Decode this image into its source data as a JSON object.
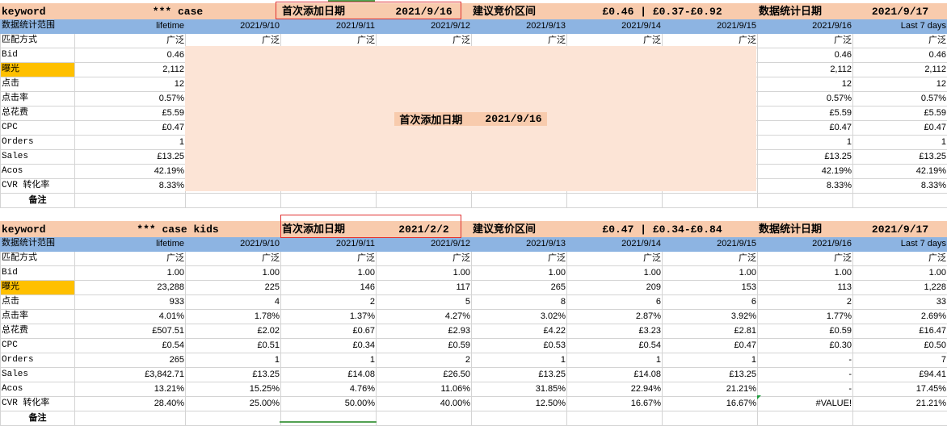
{
  "sections": [
    {
      "header": {
        "col0": "keyword",
        "keyword": "*** case",
        "first_add_label": "首次添加日期",
        "first_add_date": "2021/9/16",
        "suggest_label": "建议竞价区间",
        "suggest_value": "£0.46  |  £0.37-£0.92",
        "stats_label": "数据统计日期",
        "stats_date": "2021/9/17"
      },
      "scope": [
        "数据统计范围",
        "lifetime",
        "2021/9/10",
        "2021/9/11",
        "2021/9/12",
        "2021/9/13",
        "2021/9/14",
        "2021/9/15",
        "2021/9/16",
        "Last 7 days"
      ],
      "rows": [
        {
          "label": "匹配方式",
          "cells": [
            "广泛",
            "广泛",
            "广泛",
            "广泛",
            "广泛",
            "广泛",
            "广泛",
            "广泛",
            "广泛"
          ]
        },
        {
          "label": "Bid",
          "cells": [
            "0.46",
            "",
            "",
            "",
            "",
            "",
            "",
            "0.46",
            "0.46"
          ]
        },
        {
          "label": "曝光",
          "cells": [
            "2,112",
            "",
            "",
            "",
            "",
            "",
            "",
            "2,112",
            "2,112"
          ],
          "highlight": true
        },
        {
          "label": "点击",
          "cells": [
            "12",
            "",
            "",
            "",
            "",
            "",
            "",
            "12",
            "12"
          ]
        },
        {
          "label": "点击率",
          "cells": [
            "0.57%",
            "",
            "",
            "",
            "",
            "",
            "",
            "0.57%",
            "0.57%"
          ]
        },
        {
          "label": "总花费",
          "cells": [
            "£5.59",
            "",
            "",
            "",
            "",
            "",
            "",
            "£5.59",
            "£5.59"
          ]
        },
        {
          "label": "CPC",
          "cells": [
            "£0.47",
            "",
            "",
            "",
            "",
            "",
            "",
            "£0.47",
            "£0.47"
          ]
        },
        {
          "label": "Orders",
          "cells": [
            "1",
            "",
            "",
            "",
            "",
            "",
            "",
            "1",
            "1"
          ]
        },
        {
          "label": "Sales",
          "cells": [
            "£13.25",
            "",
            "",
            "",
            "",
            "",
            "",
            "£13.25",
            "£13.25"
          ]
        },
        {
          "label": "Acos",
          "cells": [
            "42.19%",
            "",
            "",
            "",
            "",
            "",
            "",
            "42.19%",
            "42.19%"
          ]
        },
        {
          "label": "CVR 转化率",
          "cells": [
            "8.33%",
            "",
            "",
            "",
            "",
            "",
            "",
            "8.33%",
            "8.33%"
          ]
        }
      ],
      "remark": "备注",
      "overlay": {
        "label": "首次添加日期",
        "date": "2021/9/16"
      }
    },
    {
      "header": {
        "col0": "keyword",
        "keyword": "*** case kids",
        "first_add_label": "首次添加日期",
        "first_add_date": "2021/2/2",
        "suggest_label": "建议竞价区间",
        "suggest_value": "£0.47  |  £0.34-£0.84",
        "stats_label": "数据统计日期",
        "stats_date": "2021/9/17"
      },
      "scope": [
        "数据统计范围",
        "lifetime",
        "2021/9/10",
        "2021/9/11",
        "2021/9/12",
        "2021/9/13",
        "2021/9/14",
        "2021/9/15",
        "2021/9/16",
        "Last 7 days"
      ],
      "rows": [
        {
          "label": "匹配方式",
          "cells": [
            "广泛",
            "广泛",
            "广泛",
            "广泛",
            "广泛",
            "广泛",
            "广泛",
            "广泛",
            "广泛"
          ]
        },
        {
          "label": "Bid",
          "cells": [
            "1.00",
            "1.00",
            "1.00",
            "1.00",
            "1.00",
            "1.00",
            "1.00",
            "1.00",
            "1.00"
          ]
        },
        {
          "label": "曝光",
          "cells": [
            "23,288",
            "225",
            "146",
            "117",
            "265",
            "209",
            "153",
            "113",
            "1,228"
          ],
          "highlight": true
        },
        {
          "label": "点击",
          "cells": [
            "933",
            "4",
            "2",
            "5",
            "8",
            "6",
            "6",
            "2",
            "33"
          ]
        },
        {
          "label": "点击率",
          "cells": [
            "4.01%",
            "1.78%",
            "1.37%",
            "4.27%",
            "3.02%",
            "2.87%",
            "3.92%",
            "1.77%",
            "2.69%"
          ]
        },
        {
          "label": "总花费",
          "cells": [
            "£507.51",
            "£2.02",
            "£0.67",
            "£2.93",
            "£4.22",
            "£3.23",
            "£2.81",
            "£0.59",
            "£16.47"
          ]
        },
        {
          "label": "CPC",
          "cells": [
            "£0.54",
            "£0.51",
            "£0.34",
            "£0.59",
            "£0.53",
            "£0.54",
            "£0.47",
            "£0.30",
            "£0.50"
          ]
        },
        {
          "label": "Orders",
          "cells": [
            "265",
            "1",
            "1",
            "2",
            "1",
            "1",
            "1",
            "-",
            "7"
          ]
        },
        {
          "label": "Sales",
          "cells": [
            "£3,842.71",
            "£13.25",
            "£14.08",
            "£26.50",
            "£13.25",
            "£14.08",
            "£13.25",
            "-",
            "£94.41"
          ]
        },
        {
          "label": "Acos",
          "cells": [
            "13.21%",
            "15.25%",
            "4.76%",
            "11.06%",
            "31.85%",
            "22.94%",
            "21.21%",
            "-",
            "17.45%"
          ]
        },
        {
          "label": "CVR 转化率",
          "cells": [
            "28.40%",
            "25.00%",
            "50.00%",
            "40.00%",
            "12.50%",
            "16.67%",
            "16.67%",
            "#VALUE!",
            "21.21%"
          ]
        }
      ],
      "remark": "备注"
    }
  ],
  "colors": {
    "header_bg": "#f8cbad",
    "scope_bg": "#8db4e2",
    "impression_bg": "#ffc000",
    "overlay_bg": "#fce4d6",
    "redbox": "#e03030"
  }
}
